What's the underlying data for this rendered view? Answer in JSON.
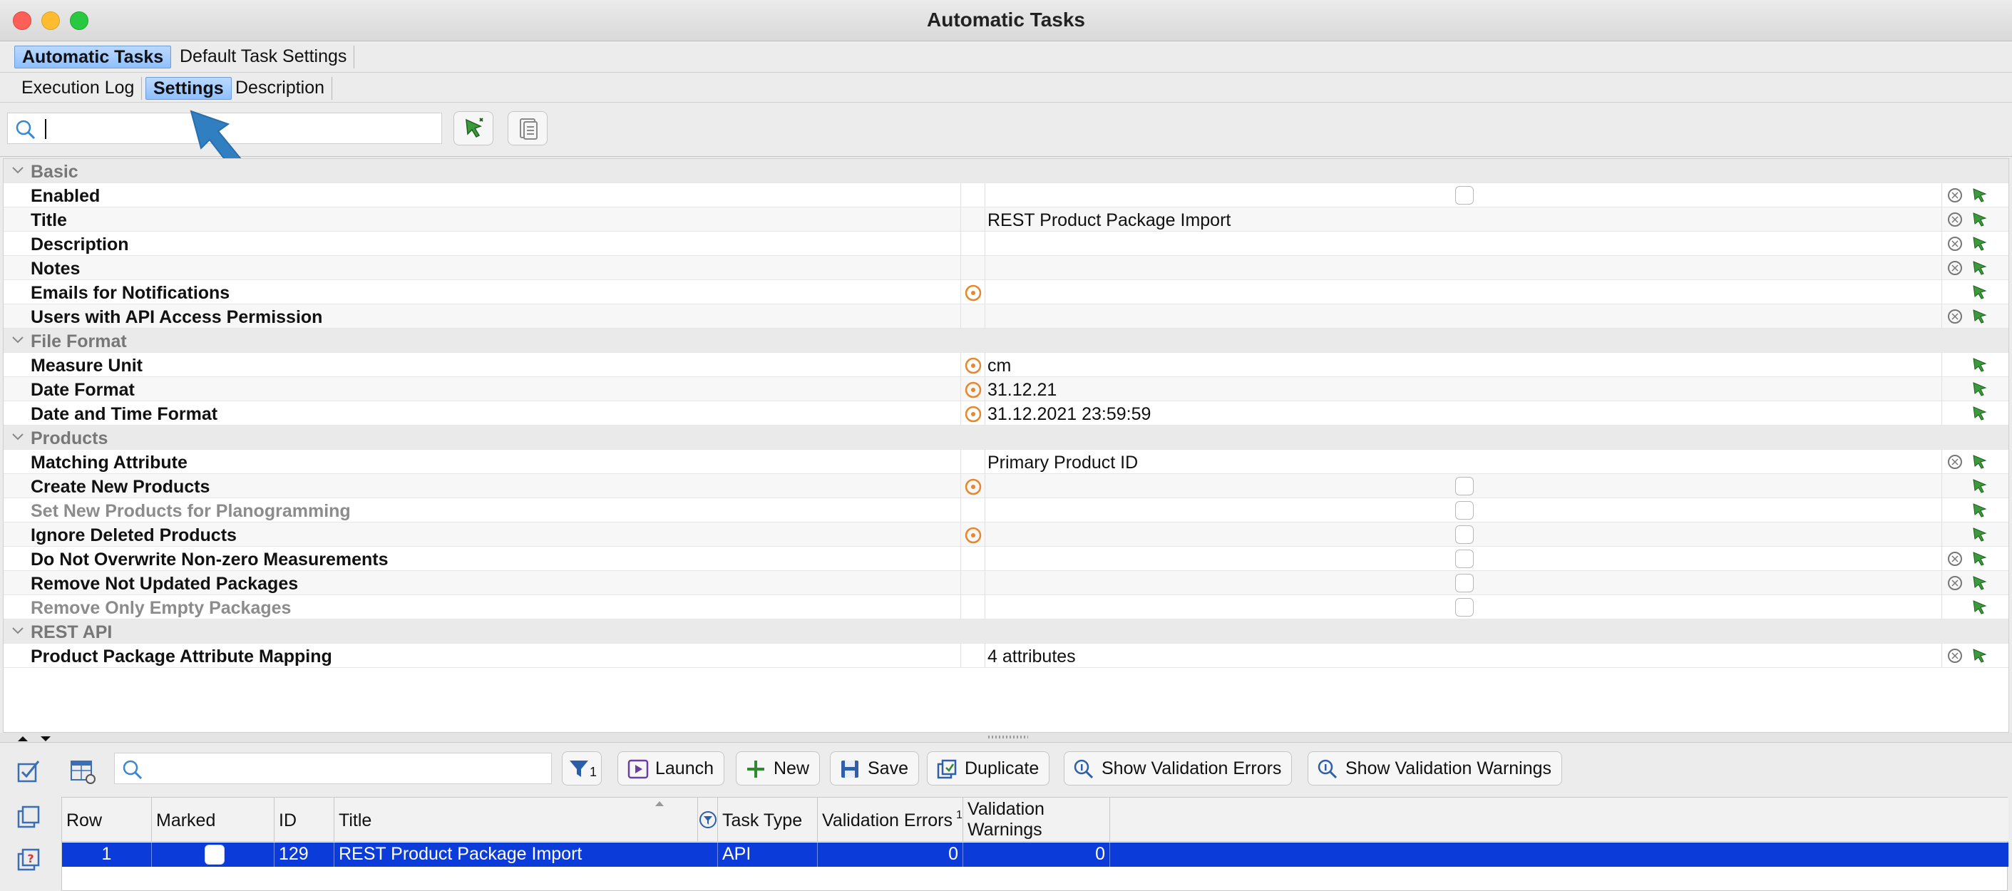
{
  "window": {
    "title": "Automatic Tasks"
  },
  "tabs_top": [
    {
      "label": "Automatic Tasks",
      "active": true
    },
    {
      "label": "Default Task Settings",
      "active": false
    }
  ],
  "tabs_sub": [
    {
      "label": "Execution Log",
      "active": false
    },
    {
      "label": "Settings",
      "active": true
    },
    {
      "label": "Description",
      "active": false
    }
  ],
  "search": {
    "value": "",
    "placeholder": ""
  },
  "groups": {
    "basic": "Basic",
    "file_format": "File Format",
    "products": "Products",
    "rest_api": "REST API"
  },
  "properties": {
    "enabled": {
      "label": "Enabled",
      "value": ""
    },
    "title": {
      "label": "Title",
      "value": "REST Product Package Import"
    },
    "description": {
      "label": "Description",
      "value": ""
    },
    "notes": {
      "label": "Notes",
      "value": ""
    },
    "emails": {
      "label": "Emails for Notifications",
      "value": ""
    },
    "users_api": {
      "label": "Users with API Access Permission",
      "value": ""
    },
    "measure_unit": {
      "label": "Measure Unit",
      "value": "cm"
    },
    "date_format": {
      "label": "Date Format",
      "value": "31.12.21"
    },
    "datetime_format": {
      "label": "Date and Time Format",
      "value": "31.12.2021 23:59:59"
    },
    "matching_attr": {
      "label": "Matching Attribute",
      "value": "Primary Product ID"
    },
    "create_new": {
      "label": "Create New Products",
      "value": ""
    },
    "set_new_plano": {
      "label": "Set New Products for Planogramming",
      "value": ""
    },
    "ignore_deleted": {
      "label": "Ignore Deleted Products",
      "value": ""
    },
    "no_overwrite": {
      "label": "Do Not Overwrite Non-zero Measurements",
      "value": ""
    },
    "remove_not_updated": {
      "label": "Remove Not Updated Packages",
      "value": ""
    },
    "remove_only_empty": {
      "label": "Remove Only Empty Packages",
      "value": ""
    },
    "pkg_attr_mapping": {
      "label": "Product Package Attribute Mapping",
      "value": "4 attributes"
    }
  },
  "bottom_toolbar": {
    "filter_count": "1",
    "launch": "Launch",
    "new": "New",
    "save": "Save",
    "duplicate": "Duplicate",
    "show_errors": "Show Validation Errors",
    "show_warnings": "Show Validation Warnings"
  },
  "table": {
    "headers": {
      "row": "Row",
      "marked": "Marked",
      "id": "ID",
      "title": "Title",
      "title_sort": "1",
      "task_type": "Task Type",
      "validation_errors": "Validation Errors",
      "validation_warnings_1": "Validation",
      "validation_warnings_2": "Warnings"
    },
    "rows": [
      {
        "row": "1",
        "id": "129",
        "title": "REST Product Package Import",
        "task_type": "API",
        "errors": "0",
        "warnings": "0"
      }
    ]
  },
  "colors": {
    "selection": "#0b3bd9",
    "active_tab": "#8ec0ff",
    "arrow": "#2f7fc1",
    "reset_icon": "#e8862a"
  }
}
